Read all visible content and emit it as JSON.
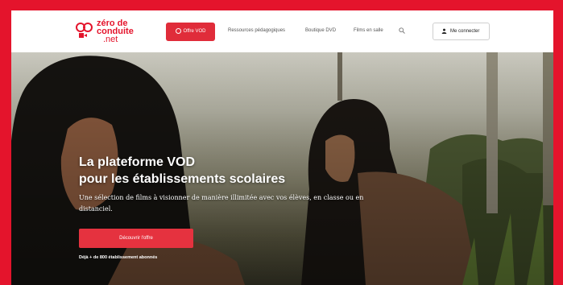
{
  "colors": {
    "brand_red": "#e4142c",
    "button_red": "#e02c3a",
    "white": "#ffffff"
  },
  "nav": {
    "logo": {
      "line1": "zéro de",
      "line2": "conduite",
      "line3": ".net",
      "icon": "film-camera-icon"
    },
    "offer_button": "Offre VOD",
    "links": [
      "Ressources pédagogiques",
      "Boutique DVD",
      "Films en salle"
    ],
    "search_icon": "search-icon",
    "login_button": "Me connecter"
  },
  "hero": {
    "title_line1": "La plateforme VOD",
    "title_line2": "pour les établissements scolaires",
    "subtitle": "Une sélection de films à visionner de manière illimitée avec vos élèves, en classe ou en distanciel.",
    "cta_button": "Découvrir l'offre",
    "note": "Déjà + de 800 établissement abonnés"
  }
}
